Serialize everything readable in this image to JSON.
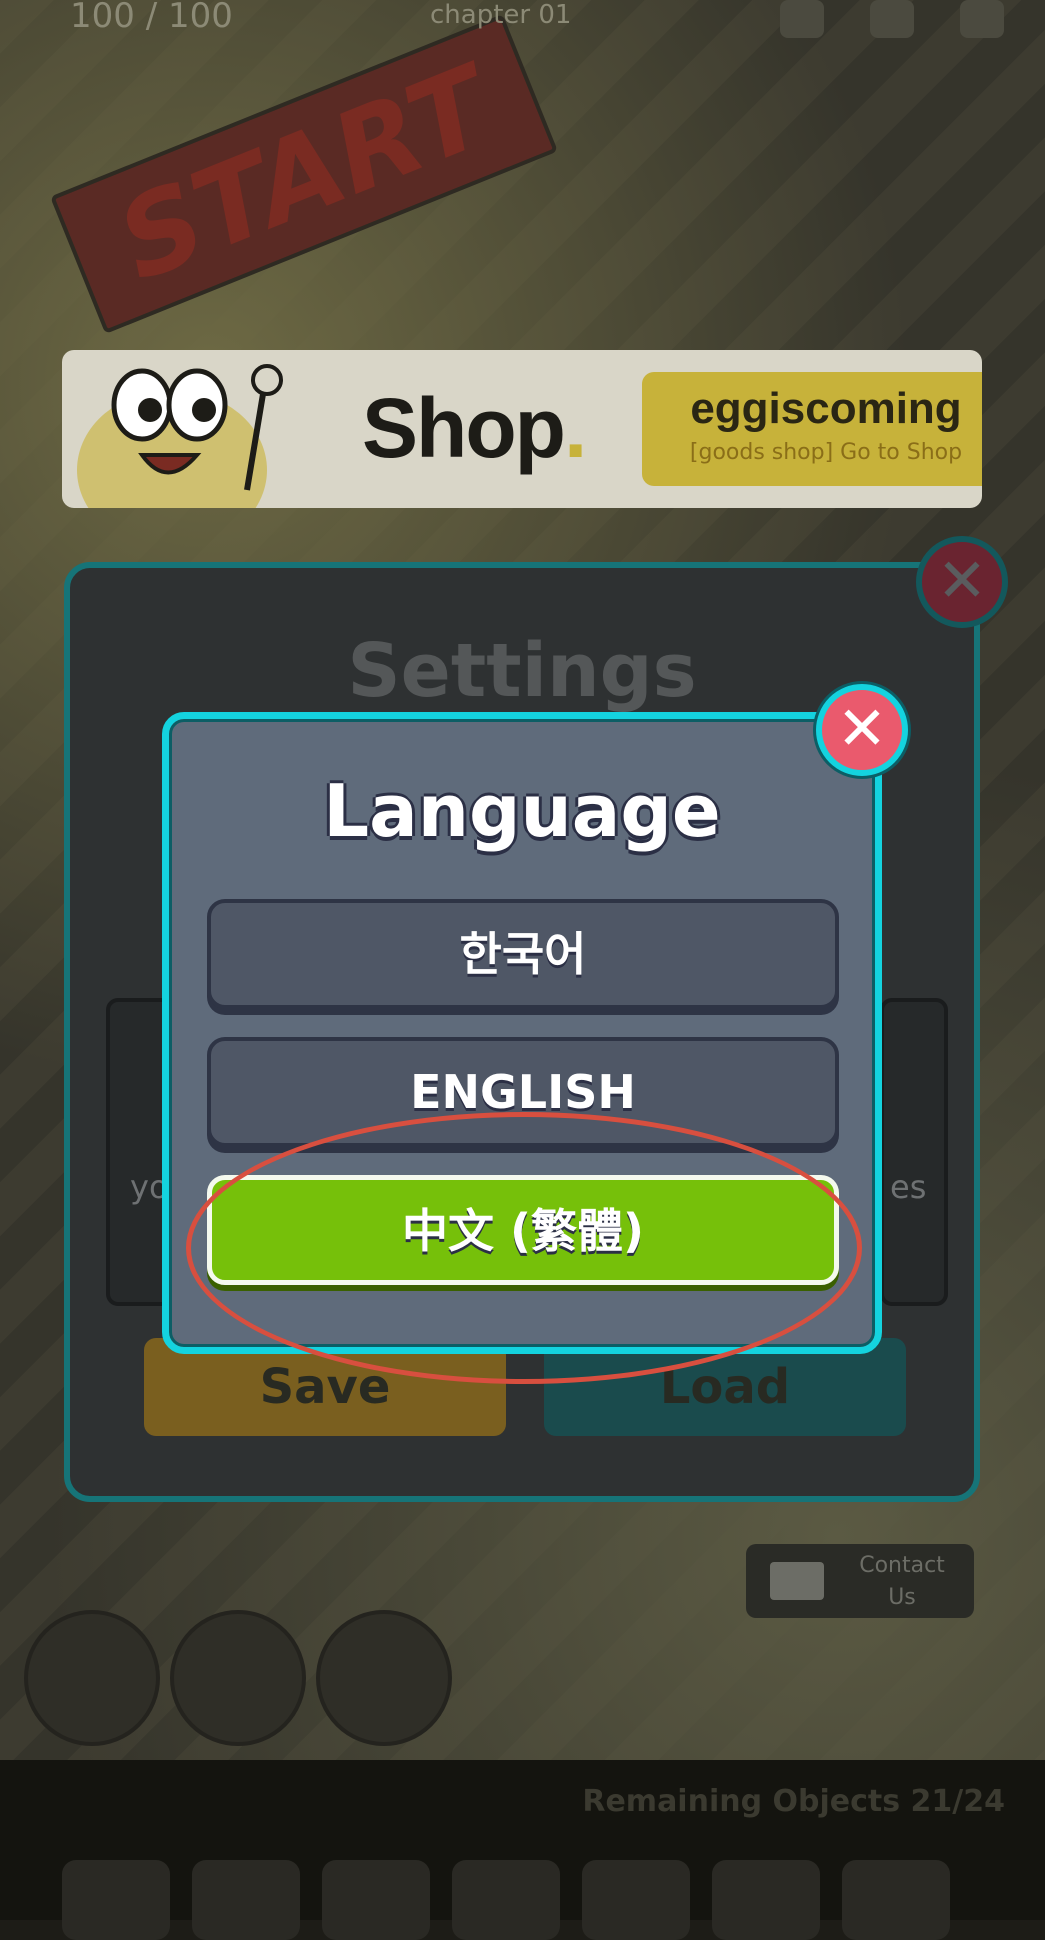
{
  "status": {
    "counter": "100 / 100",
    "chapter": "chapter 01"
  },
  "background": {
    "banner_text": "START"
  },
  "shop_banner": {
    "title": "Shop",
    "title_dot": ".",
    "brand": "eggiscoming",
    "subtitle": "[goods shop] Go to Shop"
  },
  "settings": {
    "title": "Settings",
    "side_text_left": "yo",
    "side_text_right": "es",
    "save_label": "Save",
    "load_label": "Load",
    "close_glyph": "✕"
  },
  "contact": {
    "label_line1": "Contact",
    "label_line2": "Us"
  },
  "bottom": {
    "remaining_label": "Remaining Objects 21/24"
  },
  "language_modal": {
    "title": "Language",
    "close_glyph": "✕",
    "options": [
      {
        "label": "한국어",
        "selected": false
      },
      {
        "label": "ENGLISH",
        "selected": false
      },
      {
        "label": "中文 (繁體)",
        "selected": true
      }
    ]
  },
  "colors": {
    "modal_bg": "#5f6b7b",
    "modal_border": "#14d3df",
    "selected_option": "#76c00a",
    "close_button": "#ea5a6d",
    "highlight_annotation": "#d84f3f"
  },
  "icons": [
    "close-icon",
    "mail-icon",
    "eye-icon",
    "settings-icon",
    "home-icon"
  ]
}
